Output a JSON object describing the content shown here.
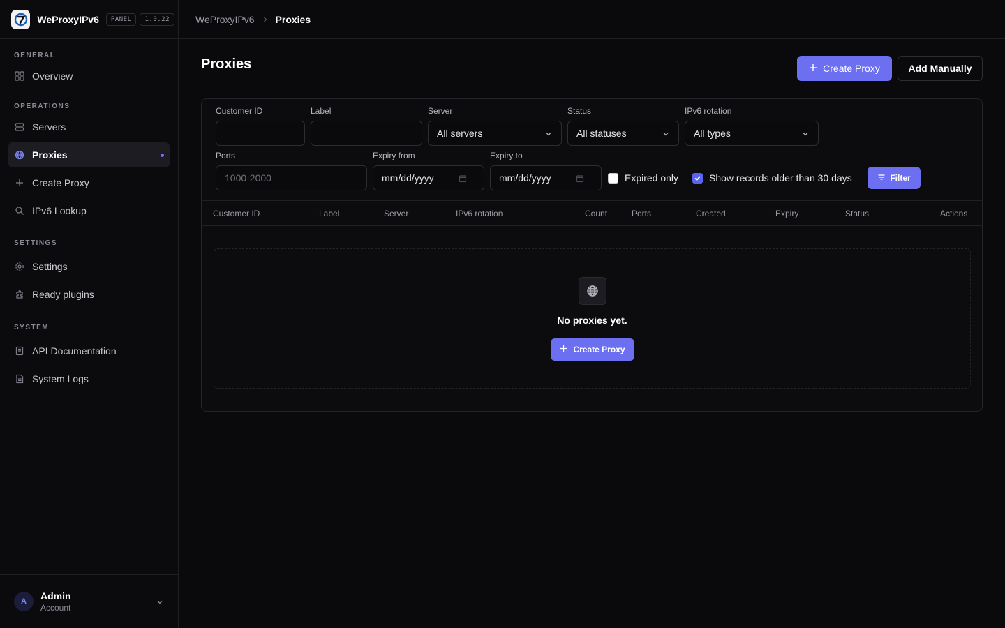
{
  "app": {
    "name": "WeProxyIPv6",
    "badge": "PANEL",
    "version": "1.0.22"
  },
  "sidebar": {
    "sections": [
      {
        "label": "GENERAL",
        "items": [
          {
            "label": "Overview",
            "icon": "grid-icon"
          }
        ]
      },
      {
        "label": "OPERATIONS",
        "items": [
          {
            "label": "Servers",
            "icon": "server-icon"
          },
          {
            "label": "Proxies",
            "icon": "globe-icon",
            "active": true
          },
          {
            "label": "Create Proxy",
            "icon": "plus-icon"
          },
          {
            "label": "IPv6 Lookup",
            "icon": "search-icon"
          }
        ]
      },
      {
        "label": "SETTINGS",
        "items": [
          {
            "label": "Settings",
            "icon": "gear-icon"
          },
          {
            "label": "Ready plugins",
            "icon": "puzzle-icon"
          }
        ]
      },
      {
        "label": "SYSTEM",
        "items": [
          {
            "label": "API Documentation",
            "icon": "book-icon"
          },
          {
            "label": "System Logs",
            "icon": "file-icon"
          }
        ]
      }
    ],
    "account": {
      "initial": "A",
      "name": "Admin",
      "subtitle": "Account"
    }
  },
  "breadcrumb": {
    "root": "WeProxyIPv6",
    "current": "Proxies"
  },
  "page": {
    "title": "Proxies",
    "create_label": "Create Proxy",
    "manual_label": "Add Manually"
  },
  "filters": {
    "customer_id": {
      "label": "Customer ID",
      "value": ""
    },
    "label": {
      "label": "Label",
      "value": ""
    },
    "server": {
      "label": "Server",
      "value": "All servers"
    },
    "status": {
      "label": "Status",
      "value": "All statuses"
    },
    "rotation": {
      "label": "IPv6 rotation",
      "value": "All types"
    },
    "ports": {
      "label": "Ports",
      "placeholder": "1000-2000"
    },
    "expiry_from": {
      "label": "Expiry from",
      "value": "mm/dd/yyyy"
    },
    "expiry_to": {
      "label": "Expiry to",
      "value": "mm/dd/yyyy"
    },
    "expired_only": {
      "label": "Expired only",
      "checked": false
    },
    "show_older": {
      "label": "Show records older than 30 days",
      "checked": true
    },
    "filter_label": "Filter"
  },
  "table": {
    "columns": [
      "Customer ID",
      "Label",
      "Server",
      "IPv6 rotation",
      "Count",
      "Ports",
      "Created",
      "Expiry",
      "Status",
      "Actions"
    ],
    "empty_text": "No proxies yet.",
    "empty_button": "Create Proxy"
  },
  "colors": {
    "accent": "#6c6ff0",
    "background": "#0a0a0c"
  }
}
